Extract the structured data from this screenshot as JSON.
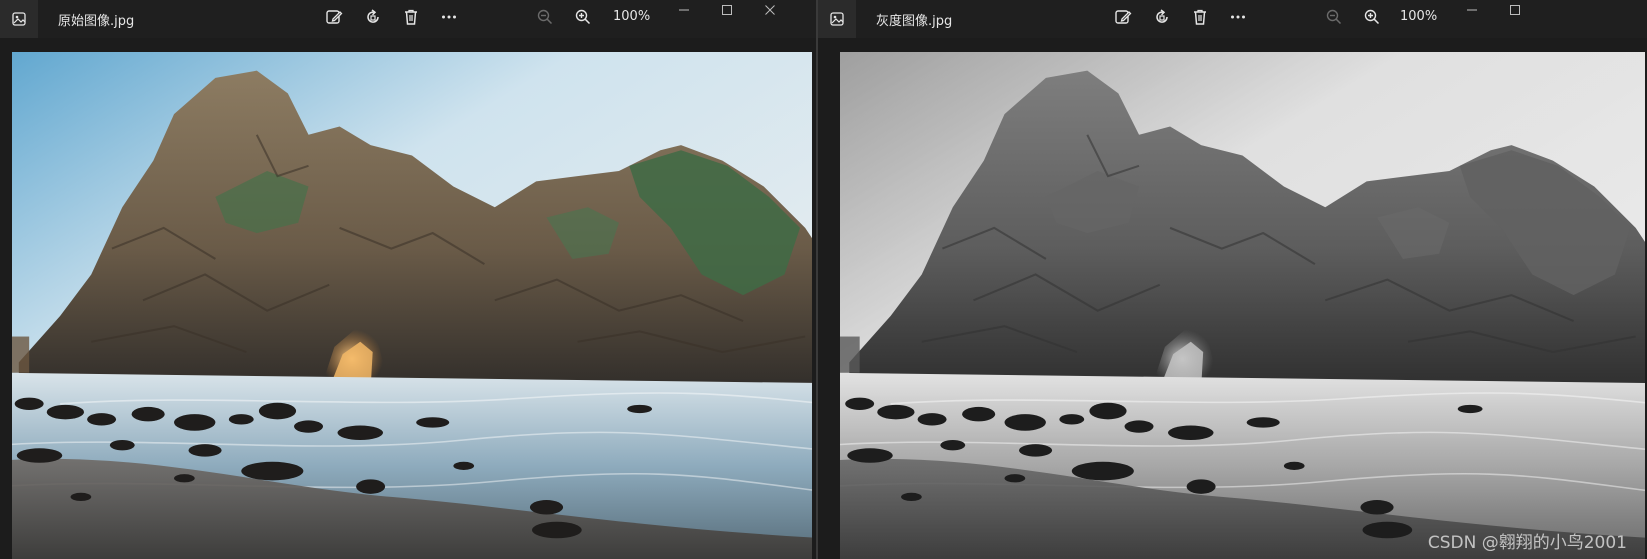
{
  "windows": [
    {
      "id": "left",
      "filename": "原始图像.jpg",
      "zoom_level": "100%",
      "image_mode": "color",
      "toolbar_icons": [
        "edit-image-icon",
        "rotate-icon",
        "delete-icon",
        "more-icon",
        "zoom-out-icon",
        "zoom-in-icon"
      ],
      "window_controls": [
        "minimize-icon",
        "maximize-icon",
        "close-icon"
      ]
    },
    {
      "id": "right",
      "filename": "灰度图像.jpg",
      "zoom_level": "100%",
      "image_mode": "grayscale",
      "toolbar_icons": [
        "edit-image-icon",
        "rotate-icon",
        "delete-icon",
        "more-icon",
        "zoom-out-icon",
        "zoom-in-icon"
      ],
      "window_controls": [
        "minimize-icon",
        "maximize-icon"
      ],
      "watermark": "CSDN @翱翔的小鸟2001"
    }
  ],
  "colors": {
    "titlebar": "#1f1f1f",
    "icon": "#e6e6e6",
    "icon_dim": "#6b6b6b"
  }
}
